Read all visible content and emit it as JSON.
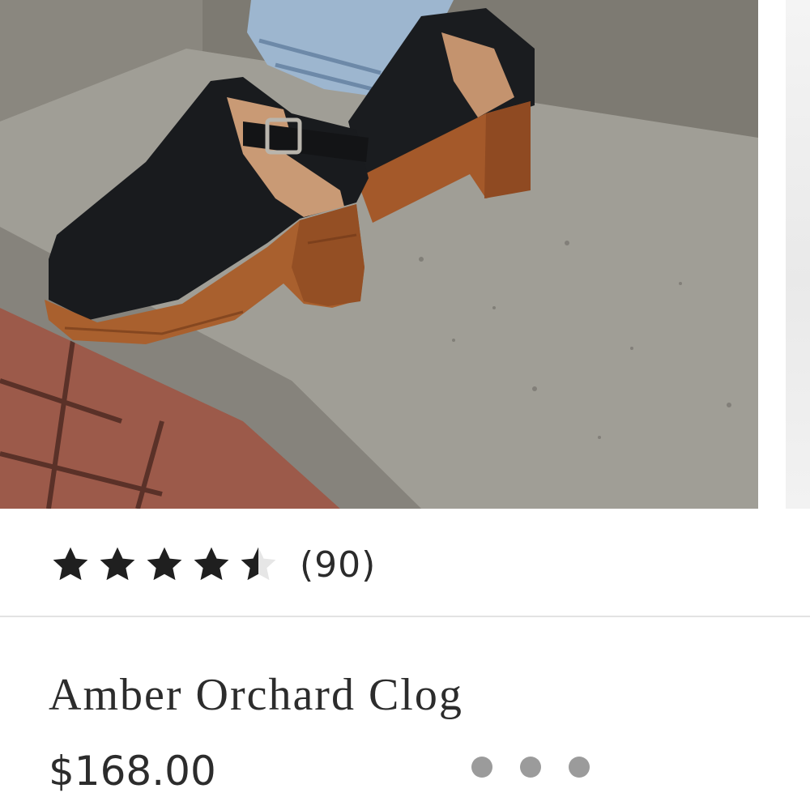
{
  "product": {
    "name": "Amber Orchard Clog",
    "price": "$168.00",
    "review_count": "(90)",
    "rating": 4.5,
    "rating_max": 5
  },
  "image": {
    "alt": "black leather clog with wooden heel on concrete step"
  },
  "carousel": {
    "page_count": 3
  },
  "colors": {
    "text": "#2c2c2c",
    "star": "#1f1f1f",
    "dot": "#9b9b9b",
    "divider": "#e3e3e3"
  },
  "icons": {
    "star": "star-icon",
    "half_star": "star-half-icon"
  }
}
